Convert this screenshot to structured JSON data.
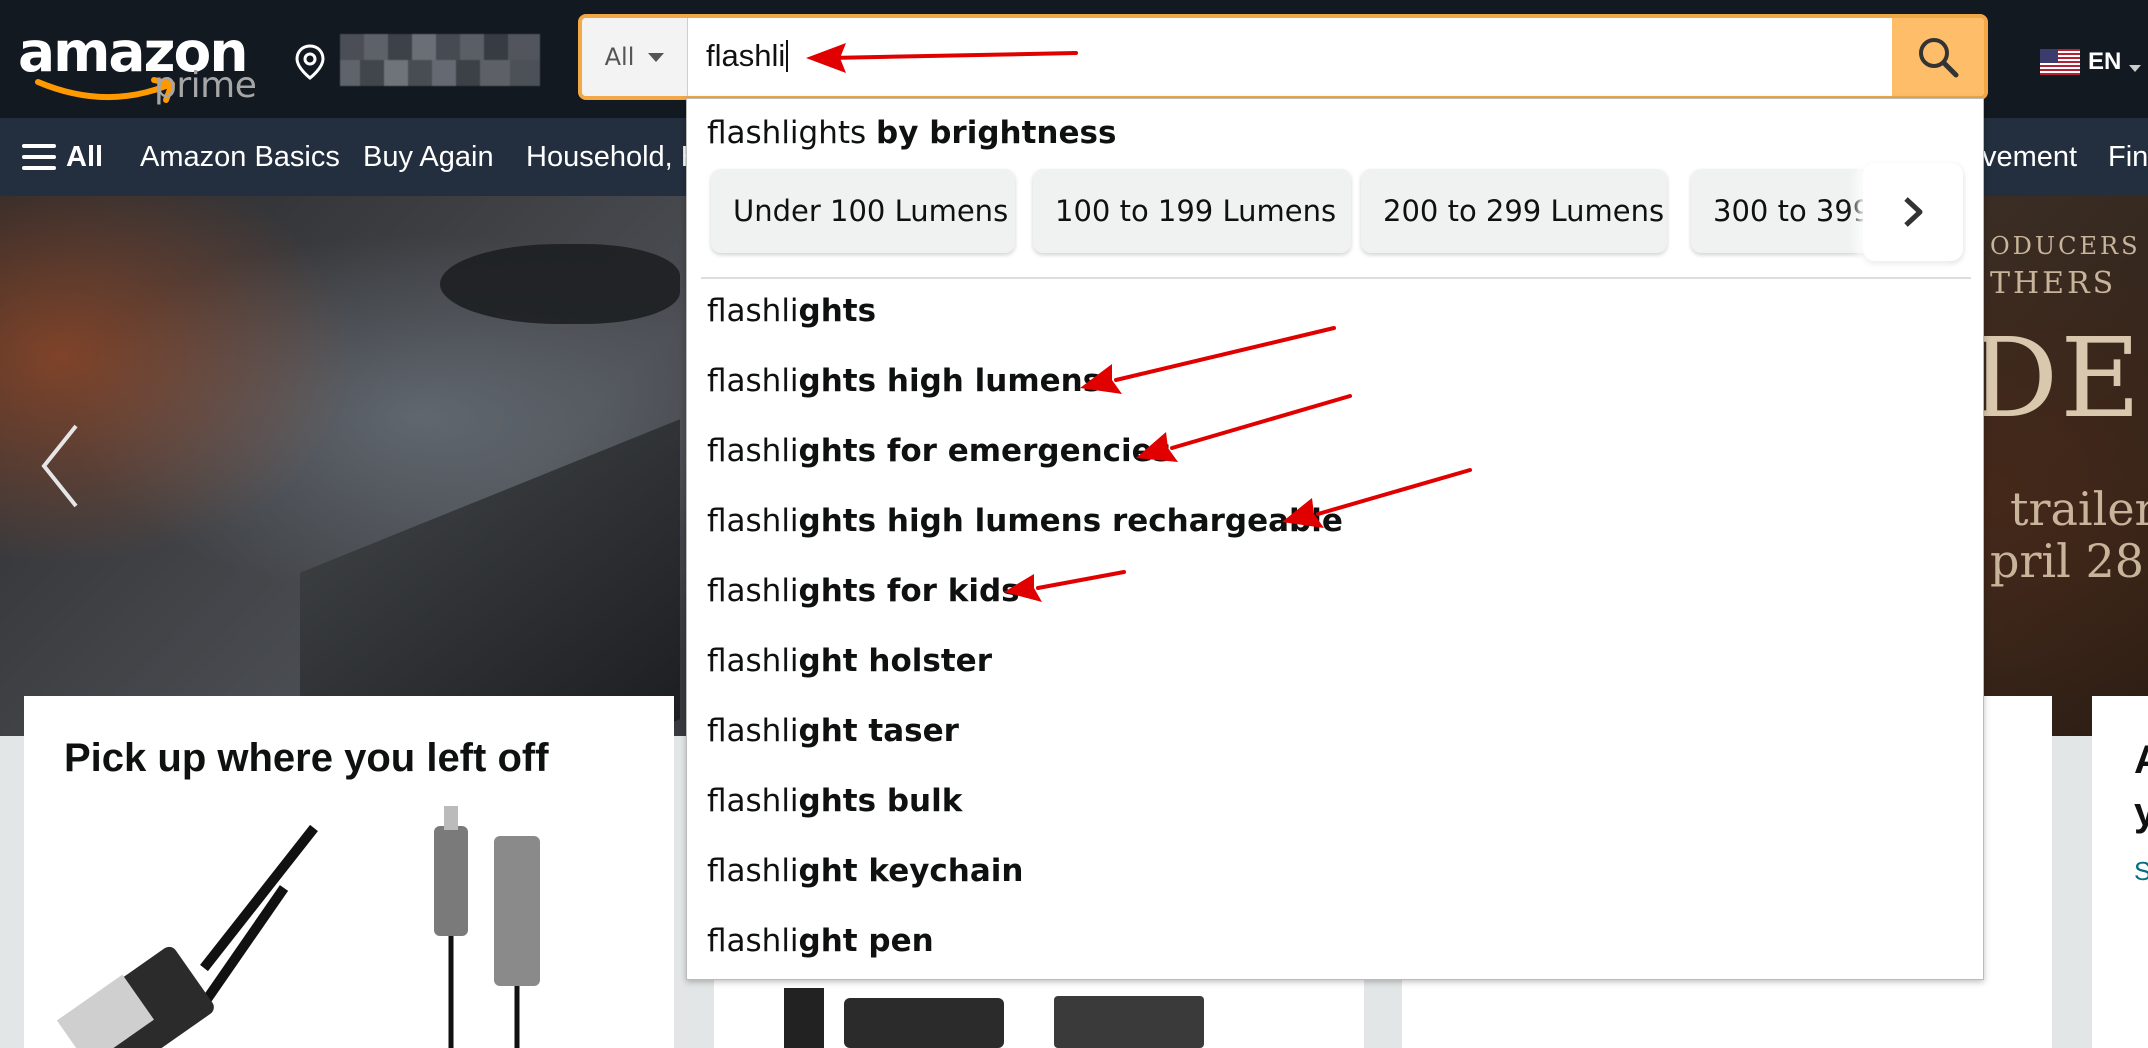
{
  "header": {
    "logo_word": "amazon",
    "logo_sub": "prime",
    "search": {
      "department": "All",
      "value": "flashli"
    },
    "language": "EN"
  },
  "subnav": {
    "all_label": "All",
    "items": [
      "Amazon Basics",
      "Buy Again",
      "Household, H",
      "vement",
      "Fin"
    ]
  },
  "hero": {
    "side_lines": [
      "ODUCERS",
      "THERS",
      "DE",
      "trailer",
      "pril 28"
    ]
  },
  "autocomplete": {
    "header_prefix": "flashlights ",
    "header_bold": "by brightness",
    "chips": [
      "Under 100 Lumens",
      "100 to 199 Lumens",
      "200 to 299 Lumens",
      "300 to 399"
    ],
    "suggestions": [
      {
        "typed": "flashli",
        "rest": "ghts"
      },
      {
        "typed": "flashli",
        "rest": "ghts high lumens"
      },
      {
        "typed": "flashli",
        "rest": "ghts for emergencies"
      },
      {
        "typed": "flashli",
        "rest": "ghts high lumens rechargeable"
      },
      {
        "typed": "flashli",
        "rest": "ghts for kids"
      },
      {
        "typed": "flashli",
        "rest": "ght holster"
      },
      {
        "typed": "flashli",
        "rest": "ght taser"
      },
      {
        "typed": "flashli",
        "rest": "ghts bulk"
      },
      {
        "typed": "flashli",
        "rest": "ght keychain"
      },
      {
        "typed": "flashli",
        "rest": "ght pen"
      }
    ]
  },
  "cards": {
    "pickup_title": "Pick up where you left off",
    "partial_a": "A",
    "partial_y": "y",
    "partial_link": "S"
  },
  "colors": {
    "nav_bg": "#131921",
    "subnav_bg": "#232f3e",
    "search_border": "#f3a847",
    "search_button": "#febd69",
    "annotation_arrow": "#e00000"
  }
}
